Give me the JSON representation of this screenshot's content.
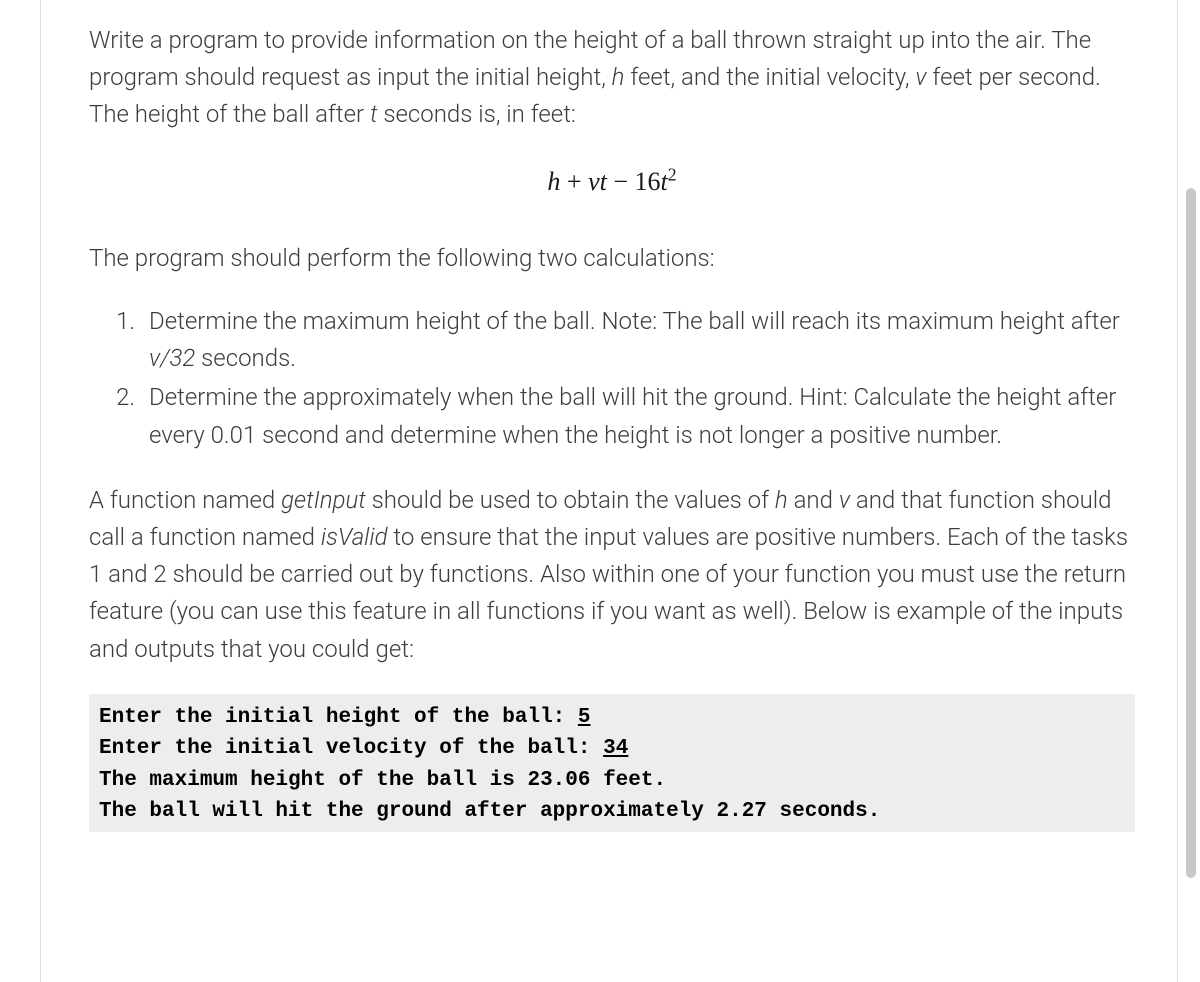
{
  "intro": {
    "part1": "Write a program to provide information on the height of a ball thrown straight up into the air.  The program should request as input the initial height, ",
    "h_var": "h",
    "part2": " feet, and the initial velocity, ",
    "v_var": "v",
    "part3": " feet per second.  The height of the ball after ",
    "t_var": "t",
    "part4": " seconds is, in feet:"
  },
  "formula": {
    "h": "h",
    "plus": " + ",
    "vt": "vt",
    "minus": " − ",
    "coef": "16",
    "t": "t",
    "exp": "2"
  },
  "para2": "The program should perform the following two calculations:",
  "list": {
    "item1_a": "Determine the maximum height of the ball.  Note: The ball will reach its maximum height after ",
    "item1_v32": "v/32",
    "item1_b": " seconds.",
    "item2": "Determine the approximately when the ball will hit the ground.  Hint: Calculate the height after every 0.01 second and determine when the height is not longer a positive number."
  },
  "para3": {
    "a": "A function named ",
    "getInput": "getInput",
    "b": " should be used to obtain the values of ",
    "h": "h",
    "c": " and  ",
    "v": "v",
    "d": " and that function should call a function named ",
    "isValid": "isValid",
    "e": " to ensure that the input values are positive numbers.  Each of the tasks 1 and 2 should be carried out by functions.  Also within one of your function you must use the return feature (you can use this feature in all functions if you want as well).  Below is example of the inputs and outputs that you could get:"
  },
  "code": {
    "line1_a": "Enter the initial height of the ball: ",
    "line1_input": "5",
    "line2_a": "Enter the initial velocity of the ball: ",
    "line2_input": "34",
    "line3": "The maximum height of the ball is 23.06 feet.",
    "line4": "The ball will hit the ground after approximately 2.27 seconds."
  }
}
